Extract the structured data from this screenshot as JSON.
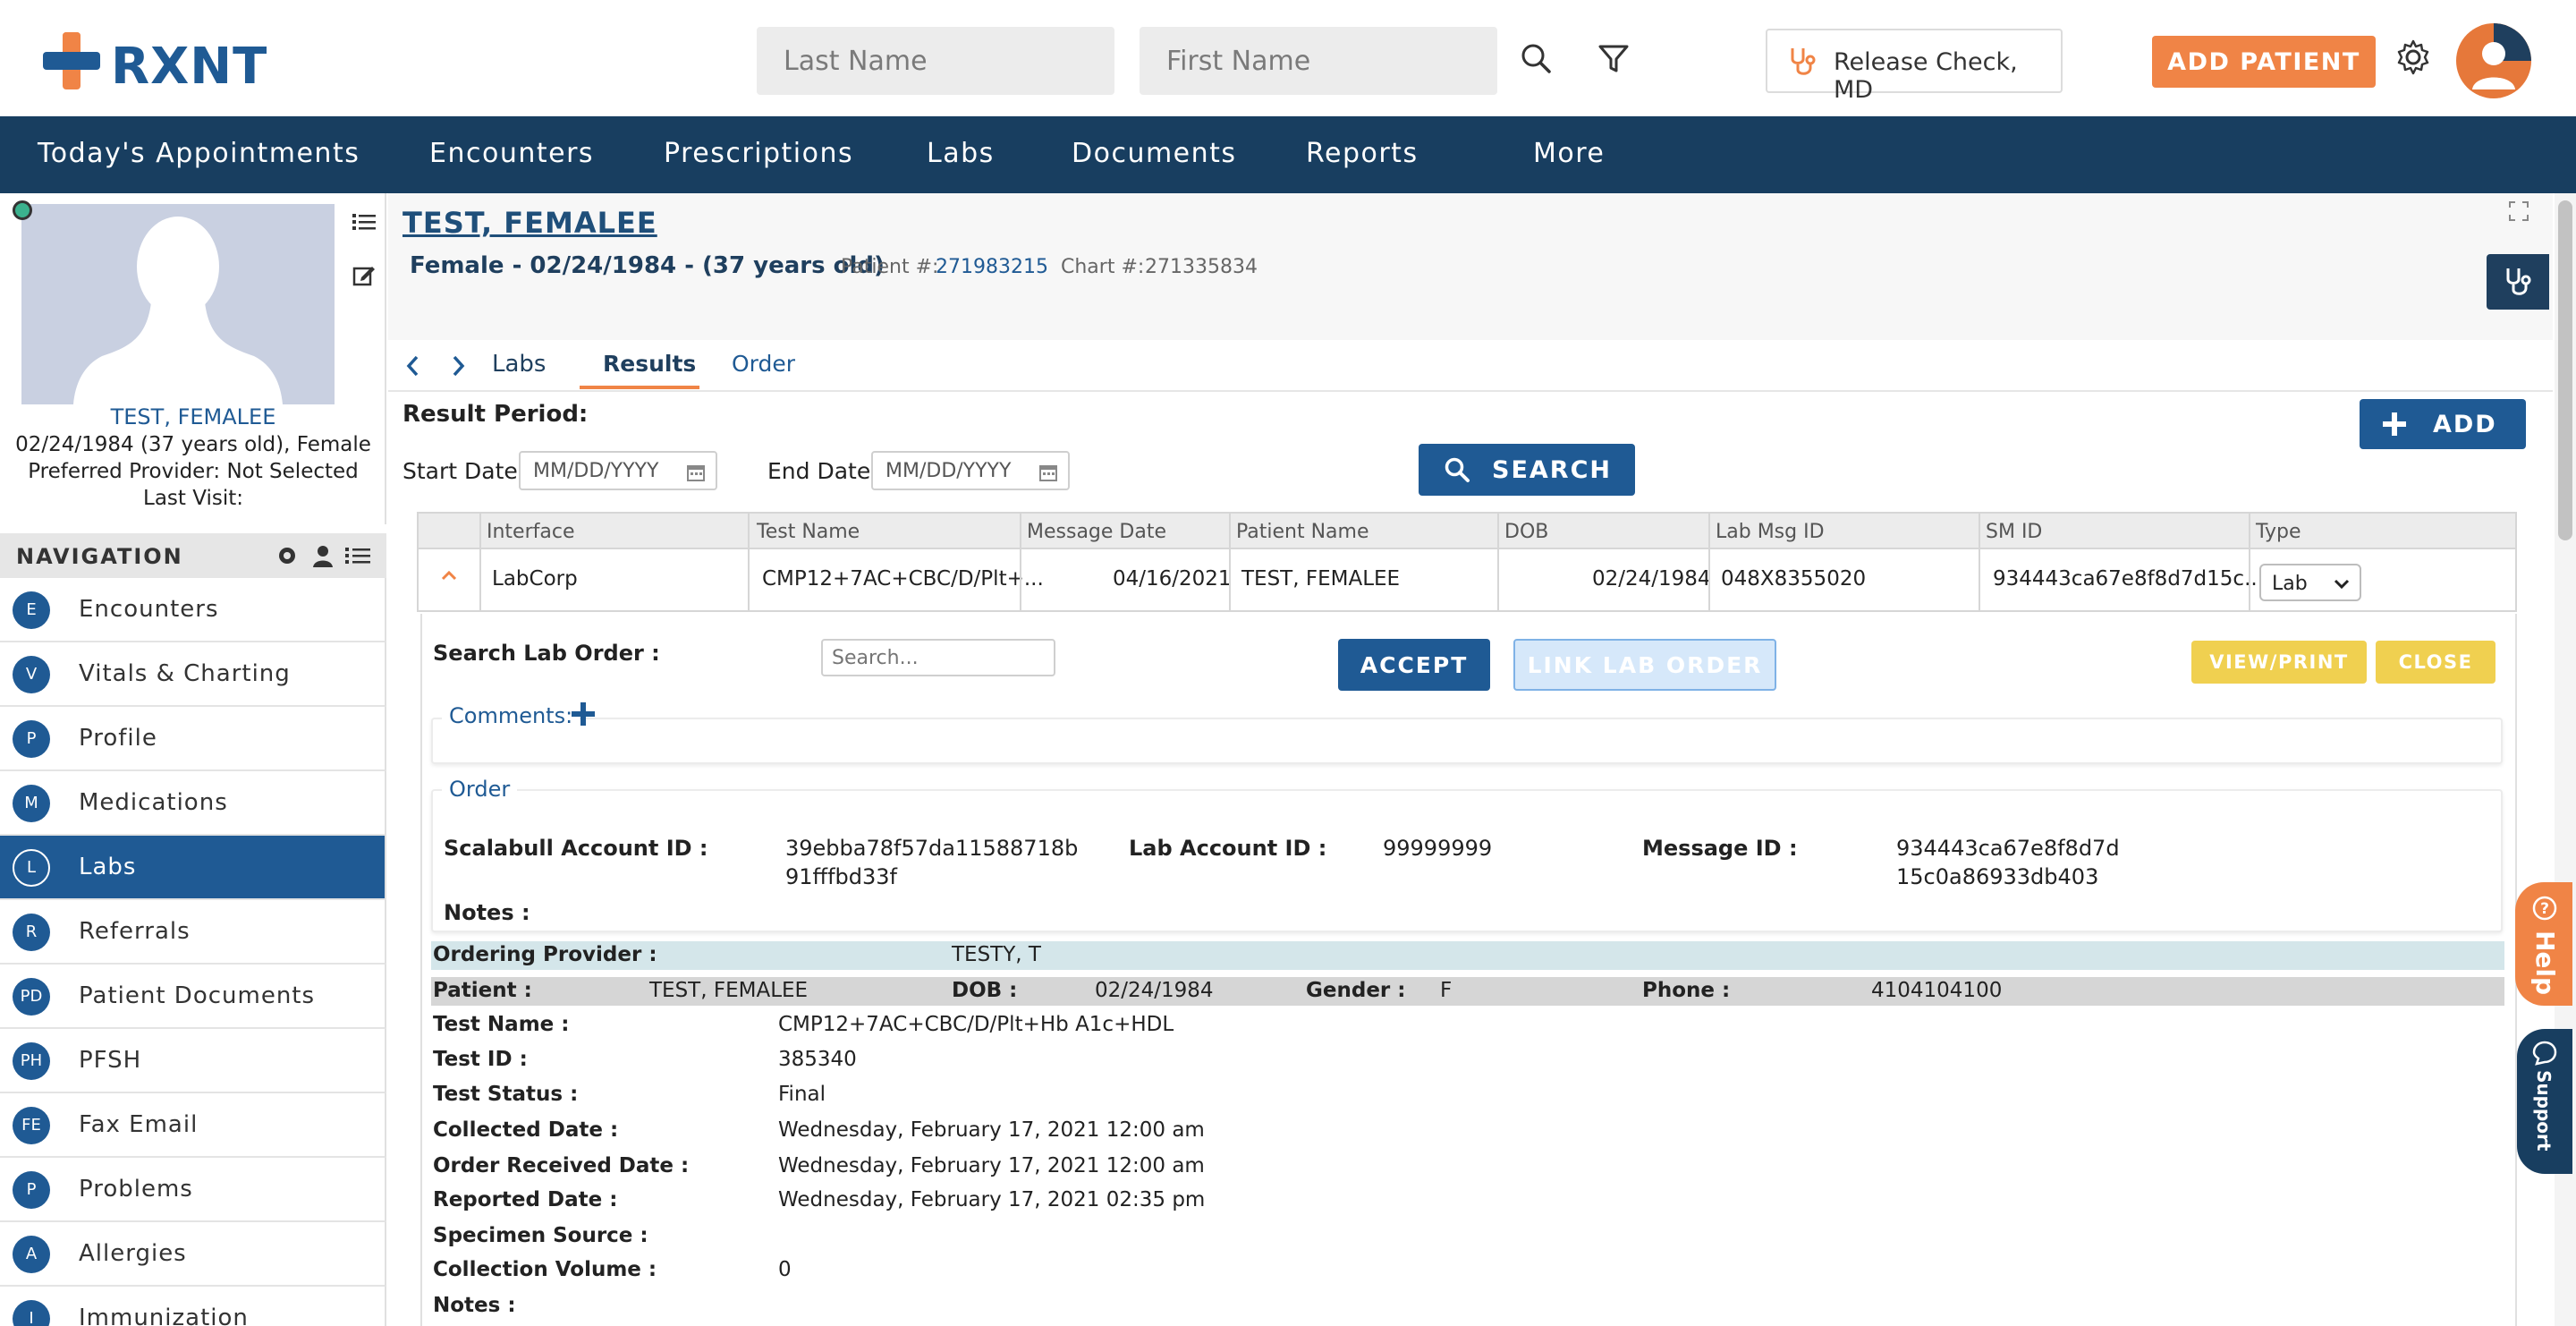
{
  "brand": {
    "name": "RXNT"
  },
  "search": {
    "last_name_placeholder": "Last Name",
    "first_name_placeholder": "First Name"
  },
  "header": {
    "provider": "Release Check, MD",
    "add_patient": "ADD PATIENT"
  },
  "nav": {
    "items": [
      "Today's Appointments",
      "Encounters",
      "Prescriptions",
      "Labs",
      "Documents",
      "Reports",
      "More"
    ]
  },
  "patient_card": {
    "name": "TEST, FEMALEE",
    "dob_line": "02/24/1984 (37 years old), Female",
    "provider_line": "Preferred Provider: Not Selected",
    "last_visit": "Last Visit:"
  },
  "sidebar": {
    "header": "NAVIGATION",
    "items": [
      {
        "badge": "E",
        "label": "Encounters"
      },
      {
        "badge": "V",
        "label": "Vitals & Charting"
      },
      {
        "badge": "P",
        "label": "Profile"
      },
      {
        "badge": "M",
        "label": "Medications"
      },
      {
        "badge": "L",
        "label": "Labs"
      },
      {
        "badge": "R",
        "label": "Referrals"
      },
      {
        "badge": "PD",
        "label": "Patient Documents"
      },
      {
        "badge": "PH",
        "label": "PFSH"
      },
      {
        "badge": "FE",
        "label": "Fax Email"
      },
      {
        "badge": "P",
        "label": "Problems"
      },
      {
        "badge": "A",
        "label": "Allergies"
      },
      {
        "badge": "I",
        "label": "Immunization"
      }
    ]
  },
  "patient_header": {
    "title": "TEST, FEMALEE",
    "subtitle": "Female - 02/24/1984 - (37 years old)",
    "patient_label": "Patient #:",
    "patient_no": "271983215",
    "chart_label": "Chart #:",
    "chart_no": "271335834"
  },
  "tabs": {
    "breadcrumb": "Labs",
    "results": "Results",
    "order": "Order"
  },
  "filters": {
    "result_period": "Result Period:",
    "start_label": "Start Date",
    "end_label": "End Date",
    "date_placeholder": "MM/DD/YYYY",
    "search_btn": "SEARCH",
    "add_btn": "ADD"
  },
  "table": {
    "columns": [
      "Interface",
      "Test Name",
      "Message Date",
      "Patient Name",
      "DOB",
      "Lab Msg ID",
      "SM ID",
      "Type"
    ],
    "row": {
      "interface": "LabCorp",
      "test_name": "CMP12+7AC+CBC/D/Plt+...",
      "message_date": "04/16/2021",
      "patient_name": "TEST, FEMALEE",
      "dob": "02/24/1984",
      "lab_msg_id": "048X8355020",
      "sm_id": "934443ca67e8f8d7d15c...",
      "type": "Lab"
    }
  },
  "detail": {
    "search_order_label": "Search Lab Order :",
    "search_placeholder": "Search...",
    "accept": "ACCEPT",
    "link": "LINK LAB ORDER",
    "view": "VIEW/PRINT",
    "close": "CLOSE",
    "comments": "Comments:",
    "order_legend": "Order",
    "scalabull_label": "Scalabull Account ID :",
    "scalabull_val_1": "39ebba78f57da11588718b",
    "scalabull_val_2": "91fffbd33f",
    "lab_account_label": "Lab Account ID :",
    "lab_account_val": "99999999",
    "message_id_label": "Message ID :",
    "message_id_val_1": "934443ca67e8f8d7d",
    "message_id_val_2": "15c0a86933db403",
    "notes_label": "Notes :",
    "ordering_provider_label": "Ordering Provider :",
    "ordering_provider_val": "TESTY, T",
    "patient_label": "Patient :",
    "patient_val": "TEST, FEMALEE",
    "dob_label": "DOB :",
    "dob_val": "02/24/1984",
    "gender_label": "Gender :",
    "gender_val": "F",
    "phone_label": "Phone :",
    "phone_val": "4104104100",
    "fields": [
      {
        "label": "Test Name :",
        "value": "CMP12+7AC+CBC/D/Plt+Hb A1c+HDL"
      },
      {
        "label": "Test ID :",
        "value": "385340"
      },
      {
        "label": "Test Status :",
        "value": "Final"
      },
      {
        "label": "Collected Date :",
        "value": "Wednesday, February 17, 2021 12:00 am"
      },
      {
        "label": "Order Received Date :",
        "value": "Wednesday, February 17, 2021 12:00 am"
      },
      {
        "label": "Reported Date :",
        "value": "Wednesday, February 17, 2021 02:35 pm"
      },
      {
        "label": "Specimen Source :",
        "value": ""
      },
      {
        "label": "Collection Volume :",
        "value": "0"
      },
      {
        "label": "Notes :",
        "value": ""
      }
    ]
  },
  "floating": {
    "help": "Help",
    "support": "Support"
  },
  "colors": {
    "primary": "#1f5a94",
    "navbar": "#183e60",
    "accent": "#f08446",
    "warning": "#f0d050"
  }
}
